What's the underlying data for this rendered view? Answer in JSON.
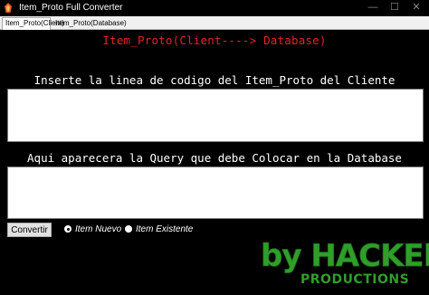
{
  "window": {
    "title": "Item_Proto Full Converter",
    "minimize_glyph": "—",
    "maximize_glyph": "☐",
    "close_glyph": "✕"
  },
  "tabs": [
    {
      "label": "Item_Proto(Client)",
      "selected": true
    },
    {
      "label": "Item_Proto(Database)",
      "selected": false
    }
  ],
  "main": {
    "header": "Item_Proto(Client----> Database)",
    "input_label": "Inserte la linea de codigo del Item_Proto del Cliente",
    "input_value": "",
    "output_label": "Aqui aparecera la Query que debe Colocar en la Database",
    "output_value": "",
    "convert_button": "Convertir",
    "radio_nuevo": "Item Nuevo",
    "radio_existente": "Item Existente",
    "selected_option": "Item Nuevo"
  },
  "logo": {
    "line1": "by HACKER",
    "line2": "PRODUCTIONS",
    "color": "#2f9e2a"
  },
  "colors": {
    "background": "#000000",
    "header_text": "#e6222a",
    "label_text": "#ffffff"
  }
}
